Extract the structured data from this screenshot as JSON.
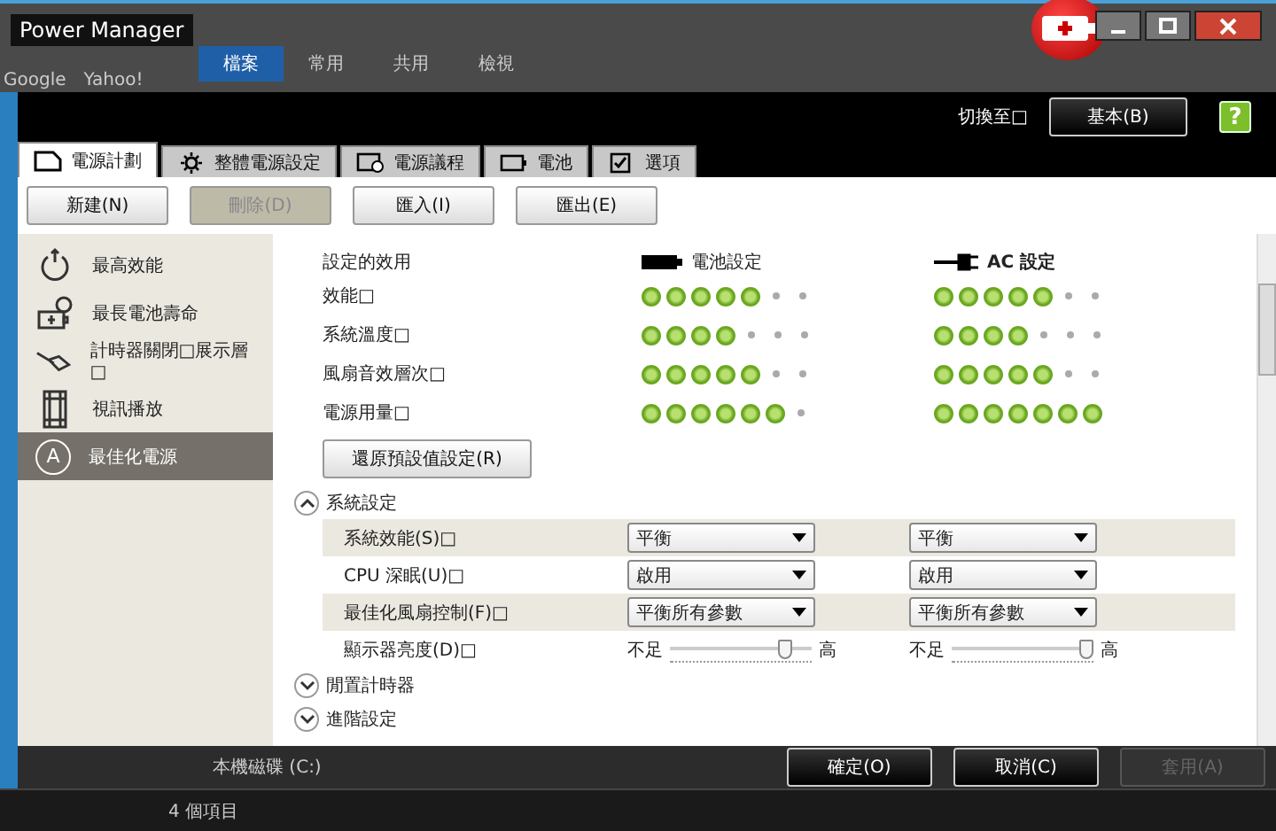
{
  "background": {
    "ribbon_tabs": [
      {
        "label": "檔案",
        "selected": true
      },
      {
        "label": "常用",
        "selected": false
      },
      {
        "label": "共用",
        "selected": false
      },
      {
        "label": "檢視",
        "selected": false
      }
    ],
    "bookmarks": [
      "Google",
      "Yahoo!"
    ],
    "drive": "本機磁碟 (C:)",
    "item_count": "4 個項目"
  },
  "window": {
    "title": "Power Manager"
  },
  "header": {
    "switch_label": "切換至□",
    "switch_button": "基本(B)",
    "help_button": "?"
  },
  "tabs": [
    {
      "label": "電源計劃",
      "kind": "plan",
      "selected": true
    },
    {
      "label": "整體電源設定",
      "kind": "gear",
      "selected": false
    },
    {
      "label": "電源議程",
      "kind": "schedule",
      "selected": false
    },
    {
      "label": "電池",
      "kind": "battery",
      "selected": false
    },
    {
      "label": "選項",
      "kind": "check",
      "selected": false
    }
  ],
  "toolbar": [
    {
      "label": "新建(N)",
      "disabled": false
    },
    {
      "label": "刪除(D)",
      "disabled": true
    },
    {
      "label": "匯入(I)",
      "disabled": false
    },
    {
      "label": "匯出(E)",
      "disabled": false
    }
  ],
  "plans": [
    {
      "label": "最高效能",
      "kind": "performance",
      "selected": false
    },
    {
      "label": "最長電池壽命",
      "kind": "battery-life",
      "selected": false
    },
    {
      "label": "計時器關閉□展示層□",
      "kind": "timer",
      "selected": false
    },
    {
      "label": "視訊播放",
      "kind": "video",
      "selected": false
    },
    {
      "label": "最佳化電源",
      "kind": "optimized",
      "icon_letter": "A",
      "selected": true
    }
  ],
  "effects": {
    "title": "設定的效用",
    "battery_label": "電池設定",
    "ac_label": "AC 設定",
    "rows": [
      {
        "label": "效能□",
        "battery": {
          "stars": 5
        },
        "ac": {
          "stars": 5
        }
      },
      {
        "label": "系統溫度□",
        "battery": {
          "stars": 4
        },
        "ac": {
          "stars": 4
        }
      },
      {
        "label": "風扇音效層次□",
        "battery": {
          "stars": 5
        },
        "ac": {
          "stars": 5
        }
      },
      {
        "label": "電源用量□",
        "battery": {
          "stars": 6
        },
        "ac": {
          "stars": 7
        }
      }
    ]
  },
  "restore_button": "還原預設值設定(R)",
  "sections": [
    {
      "title": "系統設定",
      "expanded": true,
      "settings": [
        {
          "kind": "select",
          "label": "系統效能(S)□",
          "battery": {
            "value": "平衡"
          },
          "ac": {
            "value": "平衡"
          }
        },
        {
          "kind": "select",
          "label": "CPU 深眠(U)□",
          "battery": {
            "value": "啟用"
          },
          "ac": {
            "value": "啟用"
          }
        },
        {
          "kind": "select",
          "label": "最佳化風扇控制(F)□",
          "battery": {
            "value": "平衡所有參數"
          },
          "ac": {
            "value": "平衡所有參數"
          }
        },
        {
          "kind": "slider",
          "label": "顯示器亮度(D)□",
          "battery": {
            "low": "不足",
            "high": "高",
            "level": 0.85
          },
          "ac": {
            "low": "不足",
            "high": "高",
            "level": 1
          }
        }
      ]
    },
    {
      "title": "閒置計時器",
      "expanded": false
    },
    {
      "title": "進階設定",
      "expanded": false
    }
  ],
  "footer": [
    {
      "label": "確定(O)",
      "disabled": false
    },
    {
      "label": "取消(C)",
      "disabled": false
    },
    {
      "label": "套用(A)",
      "disabled": true
    }
  ]
}
